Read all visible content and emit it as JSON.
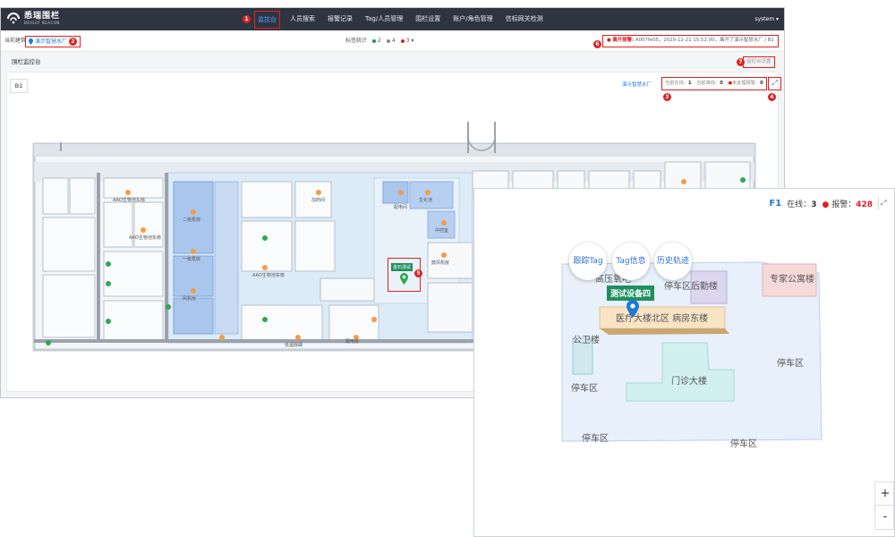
{
  "app": {
    "logo_text": "悉瑞围栏",
    "logo_sub": "BRIGHT BEACON"
  },
  "nav": {
    "marker": "1",
    "items": [
      {
        "label": "监控台",
        "active": true
      },
      {
        "label": "人员搜索"
      },
      {
        "label": "报警记录"
      },
      {
        "label": "Tag/人员管理"
      },
      {
        "label": "围栏设置"
      },
      {
        "label": "账户/角色管理"
      },
      {
        "label": "信标网关检测"
      }
    ],
    "user": "system ▾"
  },
  "info_bar": {
    "building_label": "当前建筑",
    "building_value": "演示智慧水厂",
    "building_marker": "2",
    "tag_stats_label": "标签统计",
    "online_count": "2",
    "offline_count": "4",
    "alarm_count": "3",
    "alarm_marker": "6",
    "alarm_title": "离开报警:",
    "alarm_text": "A007fe05，2020-12-21 15:52:00，离开了演示智慧水厂 / B1"
  },
  "panel": {
    "title": "围栏监控台",
    "settings_marker": "7",
    "settings_label": "监控台设置",
    "floor": "B1",
    "map_building": "演示智慧水厂",
    "stats_marker": "3",
    "online_label": "当前在线：",
    "online_value": "1",
    "offline_label": "当前离线：",
    "offline_value": "0",
    "unhandled_label": "未处理报警：",
    "unhandled_value": "0",
    "fullscreen_marker": "4",
    "device_label": "首石测试",
    "device_marker": "5",
    "room_labels": [
      "AAO生物池东南",
      "加药间",
      "生化池",
      "配电间",
      "中控室",
      "二级泵房",
      "AAO生物池东南",
      "AAO生物池东南",
      "风机房",
      "鼓风机房",
      "低温除磷",
      "一级泵房",
      "配电房"
    ]
  },
  "campus": {
    "floor": "F1",
    "online_label": "在线：",
    "online_value": "3",
    "alarm_label": "报警：",
    "alarm_value": "428",
    "action_buttons": [
      "跟踪Tag",
      "Tag信息",
      "历史轨迹"
    ],
    "device_name": "测试设备四",
    "zones": [
      "高压氧吧",
      "专家公寓楼",
      "停车区后勤楼",
      "医疗大楼北区 病房东楼",
      "公卫楼",
      "停车区",
      "门诊大楼",
      "停车区",
      "停车区",
      "停车区"
    ],
    "zoom_in": "+",
    "zoom_out": "-"
  },
  "colors": {
    "topbar": "#2f3441",
    "accent": "#1d7bd8",
    "alarm": "#e02020",
    "online": "#1f8f5f"
  }
}
